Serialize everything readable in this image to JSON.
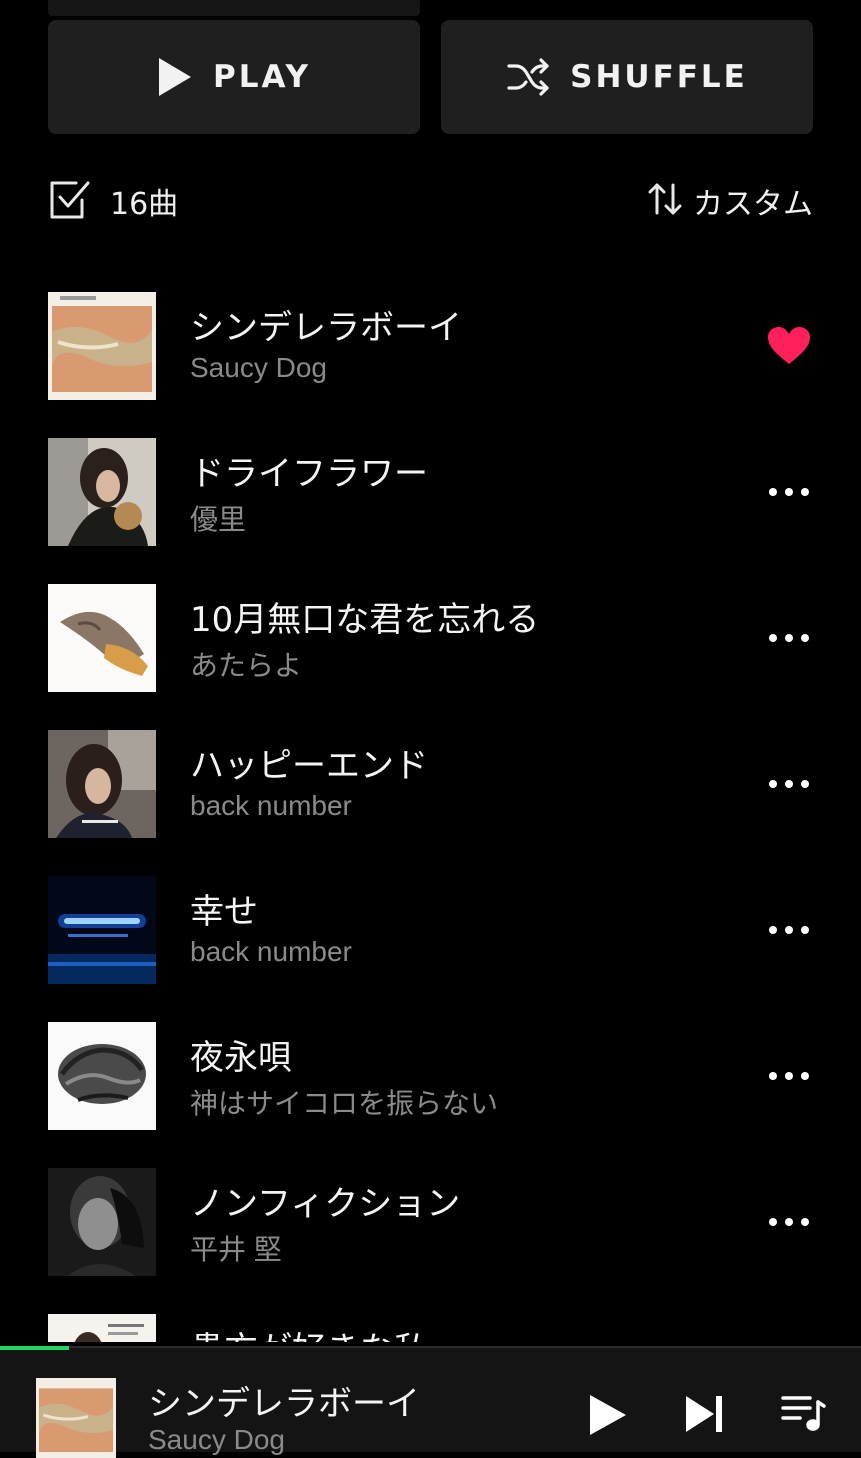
{
  "actions": {
    "play_label": "PLAY",
    "shuffle_label": "SHUFFLE"
  },
  "list_header": {
    "count": "16曲",
    "sort_label": "カスタム"
  },
  "tracks": [
    {
      "title": "シンデレラボーイ",
      "artist": "Saucy Dog",
      "liked": true,
      "art_icon": "album-art-cinderella-boy"
    },
    {
      "title": "ドライフラワー",
      "artist": "優里",
      "liked": false,
      "art_icon": "album-art-dry-flower"
    },
    {
      "title": "10月無口な君を忘れる",
      "artist": "あたらよ",
      "liked": false,
      "art_icon": "album-art-atarayo"
    },
    {
      "title": "ハッピーエンド",
      "artist": "back number",
      "liked": false,
      "art_icon": "album-art-happy-end"
    },
    {
      "title": "幸せ",
      "artist": "back number",
      "liked": false,
      "art_icon": "album-art-shiawase"
    },
    {
      "title": "夜永唄",
      "artist": "神はサイコロを振らない",
      "liked": false,
      "art_icon": "album-art-yonaga-uta"
    },
    {
      "title": "ノンフィクション",
      "artist": "平井 堅",
      "liked": false,
      "art_icon": "album-art-nonfiction"
    },
    {
      "title": "貴方が好きな私",
      "artist": "",
      "liked": false,
      "art_icon": "album-art-partial"
    }
  ],
  "now_playing": {
    "title": "シンデレラボーイ",
    "artist": "Saucy Dog",
    "progress": 0.08
  },
  "colors": {
    "background": "#000000",
    "button_bg": "#1f1f1f",
    "heart": "#ff1f5a",
    "progress": "#1ed760",
    "secondary_text": "#8a8a8a"
  }
}
